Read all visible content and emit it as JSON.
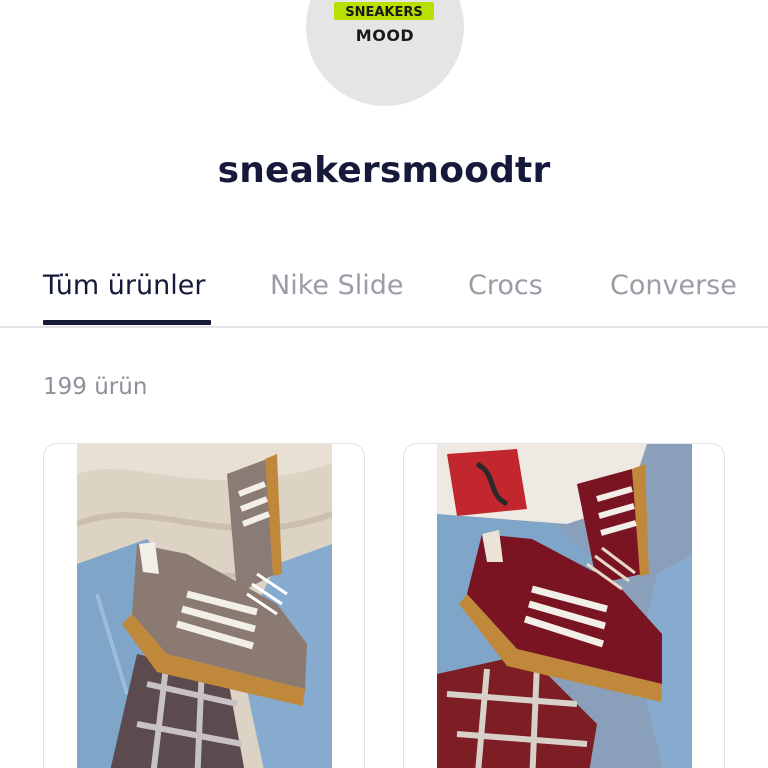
{
  "store": {
    "avatar_logo_text": "SNEAKERS",
    "avatar_sub_text": "MOOD",
    "name": "sneakersmoodtr"
  },
  "tabs": [
    {
      "label": "Tüm ürünler",
      "active": true
    },
    {
      "label": "Nike Slide",
      "active": false
    },
    {
      "label": "Crocs",
      "active": false
    },
    {
      "label": "Converse",
      "active": false
    }
  ],
  "product_count": "199 ürün",
  "products": [
    {
      "image_icon": "sneaker-photo-grey-suede",
      "color": "#8a7a72"
    },
    {
      "image_icon": "sneaker-photo-burgundy-suede",
      "color": "#7a1422"
    }
  ],
  "colors": {
    "text_primary": "#161a3a",
    "text_muted": "#9a9ca6",
    "avatar_bg": "#e5e5e5",
    "logo_accent": "#b8e000"
  }
}
